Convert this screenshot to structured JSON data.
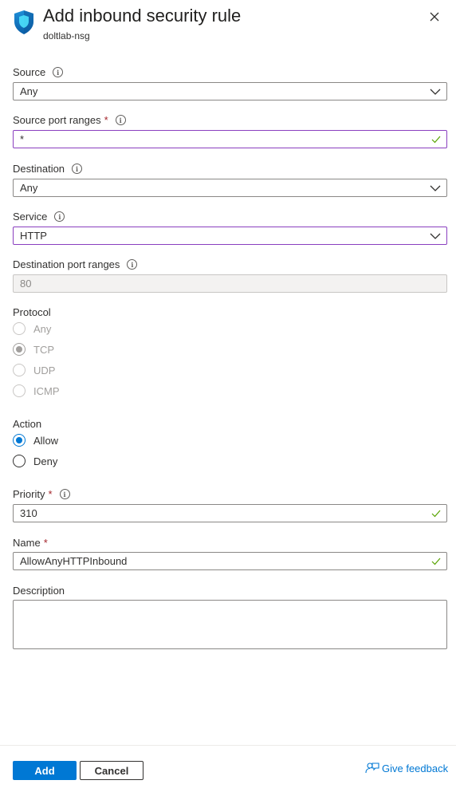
{
  "header": {
    "title": "Add inbound security rule",
    "subtitle": "doltlab-nsg"
  },
  "form": {
    "source": {
      "label": "Source",
      "value": "Any"
    },
    "source_port_ranges": {
      "label": "Source port ranges",
      "required": "*",
      "value": "*"
    },
    "destination": {
      "label": "Destination",
      "value": "Any"
    },
    "service": {
      "label": "Service",
      "value": "HTTP"
    },
    "destination_port_ranges": {
      "label": "Destination port ranges",
      "value": "80"
    },
    "protocol": {
      "label": "Protocol",
      "options": [
        "Any",
        "TCP",
        "UDP",
        "ICMP"
      ],
      "selected": "TCP"
    },
    "action": {
      "label": "Action",
      "options": [
        "Allow",
        "Deny"
      ],
      "selected": "Allow"
    },
    "priority": {
      "label": "Priority",
      "required": "*",
      "value": "310"
    },
    "name": {
      "label": "Name",
      "required": "*",
      "value": "AllowAnyHTTPInbound"
    },
    "description": {
      "label": "Description",
      "value": ""
    }
  },
  "footer": {
    "add_label": "Add",
    "cancel_label": "Cancel",
    "feedback_label": "Give feedback"
  },
  "colors": {
    "accent": "#0078d4",
    "valid_check": "#57a300",
    "focus_border": "#8a3fbf",
    "required": "#a4262c"
  }
}
